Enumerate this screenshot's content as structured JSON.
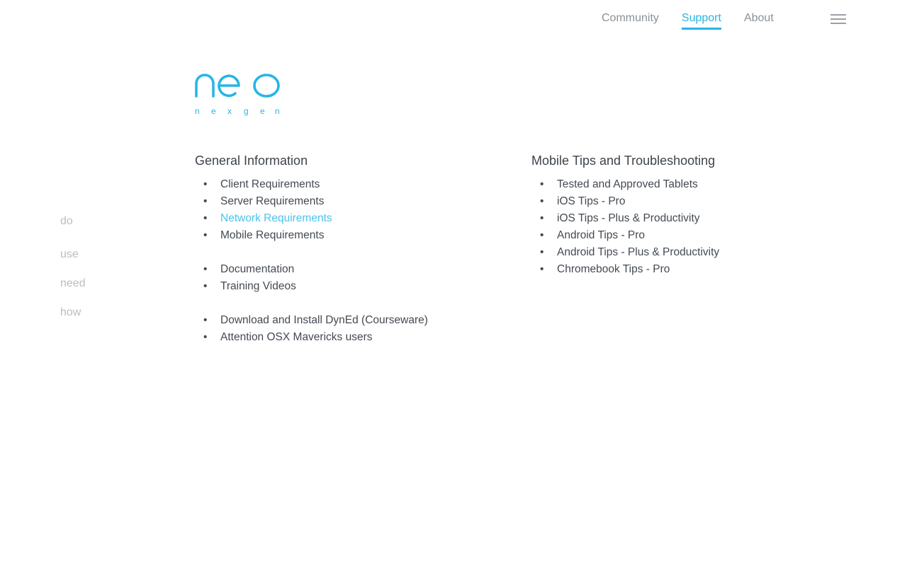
{
  "nav": {
    "items": [
      {
        "label": "Community",
        "active": false
      },
      {
        "label": "Support",
        "active": true
      },
      {
        "label": "About",
        "active": false
      }
    ],
    "accent_color": "#27b5e6"
  },
  "menu_icon": "hamburger-menu-icon",
  "logo": {
    "wordmark": "neo",
    "tagline": "n e x g e n",
    "color": "#27b5e6"
  },
  "side_words": [
    "do",
    "use",
    "need",
    "how"
  ],
  "general": {
    "heading": "General Information",
    "groups": [
      [
        {
          "label": "Client Requirements",
          "highlight": false
        },
        {
          "label": "Server Requirements",
          "highlight": false
        },
        {
          "label": "Network Requirements",
          "highlight": true
        },
        {
          "label": "Mobile Requirements",
          "highlight": false
        }
      ],
      [
        {
          "label": "Documentation",
          "highlight": false
        },
        {
          "label": "Training Videos",
          "highlight": false
        }
      ],
      [
        {
          "label": "Download and Install DynEd (Courseware)",
          "highlight": false
        },
        {
          "label": "Attention OSX Mavericks users",
          "highlight": false
        }
      ]
    ]
  },
  "mobile": {
    "heading": "Mobile Tips and Troubleshooting",
    "items": [
      "Tested and Approved Tablets",
      "iOS Tips - Pro",
      "iOS Tips - Plus & Productivity",
      "Android Tips - Pro",
      "Android Tips - Plus & Productivity",
      "Chromebook Tips - Pro"
    ]
  }
}
